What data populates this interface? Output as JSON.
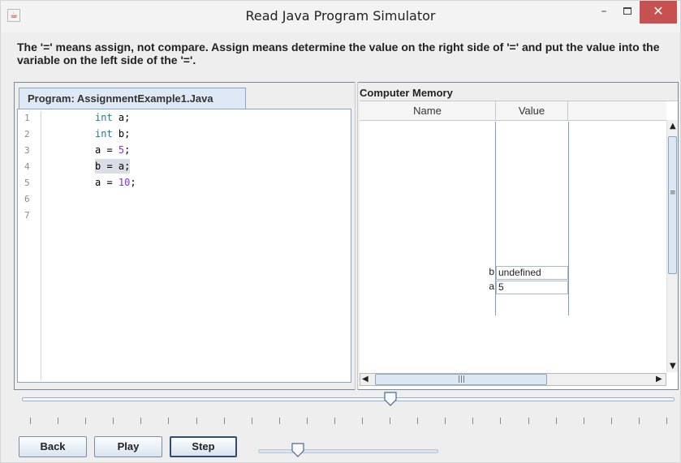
{
  "window": {
    "title": "Read Java Program Simulator"
  },
  "description": "The '=' means assign, not compare. Assign means determine the value on the right side of '=' and put the value into the variable on the left side of the '='.",
  "program": {
    "tab_label": "Program: AssignmentExample1.Java",
    "line_numbers": [
      "1",
      "2",
      "3",
      "4",
      "5",
      "6",
      "7"
    ],
    "highlighted_line": 4,
    "lines": [
      {
        "keyword": "int",
        "rest": " a;"
      },
      {
        "keyword": "int",
        "rest": " b;"
      },
      {
        "lhs": "a = ",
        "number": "5",
        "end": ";"
      },
      {
        "lhs": "b = a;",
        "number": "",
        "end": ""
      },
      {
        "lhs": "a = ",
        "number": "10",
        "end": ";"
      }
    ]
  },
  "memory": {
    "label": "Computer Memory",
    "columns": [
      "Name",
      "Value"
    ],
    "variables": [
      {
        "name": "b",
        "value": "undefined"
      },
      {
        "name": "a",
        "value": "5"
      }
    ]
  },
  "timeline": {
    "position": 0.565,
    "tick_count": 24
  },
  "controls": {
    "back_label": "Back",
    "play_label": "Play",
    "step_label": "Step",
    "speed_position": 0.22
  },
  "icons": {
    "app": "java-cup-icon",
    "minimize": "minimize-icon",
    "maximize": "maximize-icon",
    "close": "close-icon"
  },
  "colors": {
    "close_button": "#c75050",
    "keyword": "#1a7d96",
    "number": "#8a2be2",
    "highlight": "#d9dde6"
  }
}
